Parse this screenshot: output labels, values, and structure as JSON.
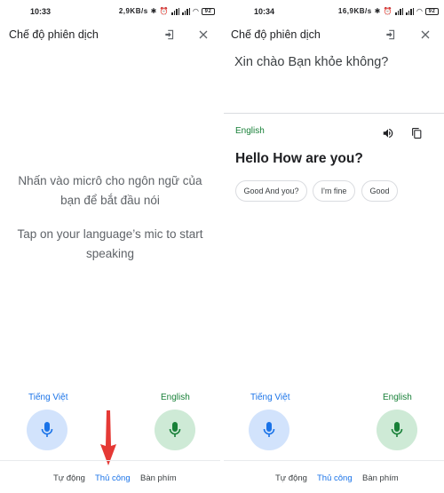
{
  "left": {
    "status": {
      "time": "10:33",
      "speed": "2,9KB/s",
      "battery": "92"
    },
    "title": "Chế độ phiên dịch",
    "hint_vi": [
      "Nhấn vào micrô cho ngôn ngữ của",
      "bạn để bắt đầu nói"
    ],
    "hint_en": [
      "Tap on your language’s mic to start",
      "speaking"
    ],
    "lang_vi": "Tiếng Việt",
    "lang_en": "English",
    "nav": {
      "auto": "Tự động",
      "manual": "Thủ công",
      "keyboard": "Bàn phím",
      "active": "manual"
    },
    "arrow_color": "#e53935"
  },
  "right": {
    "status": {
      "time": "10:34",
      "speed": "16,9KB/s",
      "battery": "92"
    },
    "title": "Chế độ phiên dịch",
    "source_text": "Xin chào Bạn khỏe không?",
    "target_lang": "English",
    "target_text": "Hello How are you?",
    "chips": [
      "Good And you?",
      "I'm fine",
      "Good"
    ],
    "lang_vi": "Tiếng Việt",
    "lang_en": "English",
    "nav": {
      "auto": "Tự động",
      "manual": "Thủ công",
      "keyboard": "Bàn phím",
      "active": "manual"
    }
  },
  "colors": {
    "blue": "#1a73e8",
    "green": "#188038",
    "mic_blue_bg": "#d2e3fc",
    "mic_green_bg": "#ceead6"
  },
  "icons": [
    "exit-fullscreen-icon",
    "close-icon",
    "mic-icon",
    "speaker-icon",
    "copy-icon",
    "arrow-down-icon"
  ]
}
